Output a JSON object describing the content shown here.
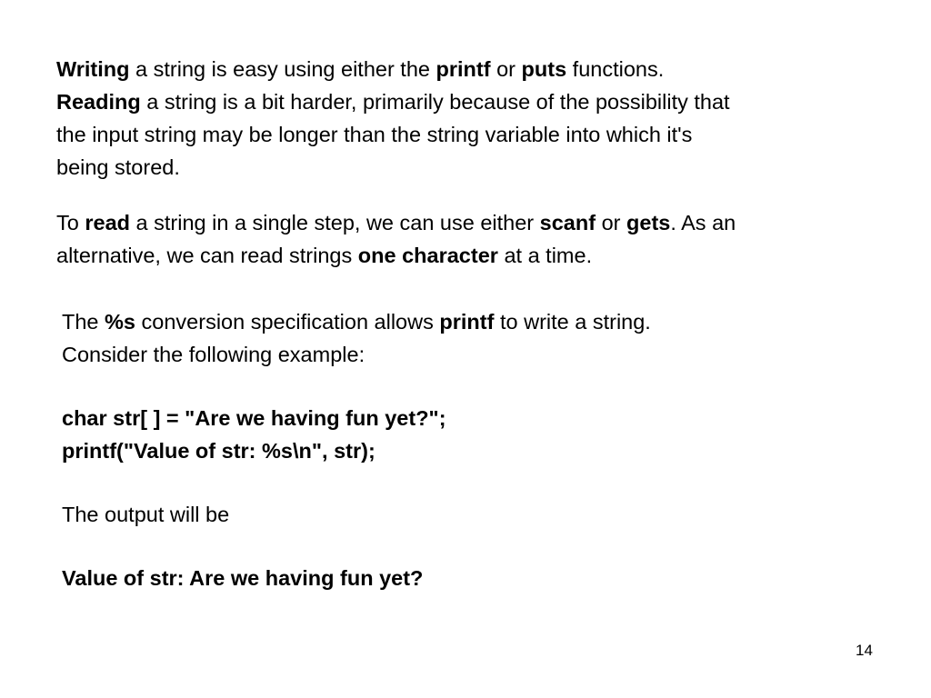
{
  "slide": {
    "page_number": "14",
    "paragraph1": {
      "l1": {
        "b1": "Writing",
        "t1": " a string is easy using either the ",
        "b2": "printf",
        "t2": " or ",
        "b3": "puts",
        "t3": " functions."
      },
      "l2": {
        "b1": "Reading",
        "t1": " a string is a bit harder, primarily because of the possibility that"
      },
      "l3": {
        "t1": "the input string may be longer than the string variable into which it's"
      },
      "l4": {
        "t1": "being stored."
      }
    },
    "paragraph2": {
      "l1": {
        "t0": "To ",
        "b1": "read",
        "t1": " a string in a single step, we can use either ",
        "b2": "scanf",
        "t2": " or ",
        "b3": "gets",
        "t3": ". As an"
      },
      "l2": {
        "t1": "alternative, we can read strings ",
        "b1": "one character",
        "t2": " at a time."
      }
    },
    "paragraph3": {
      "l1": {
        "t0": "The ",
        "b1": "%s",
        "t1": " conversion specification allows ",
        "b2": "printf",
        "t2": " to write a string."
      },
      "l2": {
        "t1": "Consider the following example:"
      },
      "code1": "char str[ ] = \"Are we having fun yet?\";",
      "code2": "printf(\"Value of str: %s\\n\", str);",
      "output_label": "The output will be",
      "output_value": "Value of str: Are we having fun yet?"
    }
  }
}
